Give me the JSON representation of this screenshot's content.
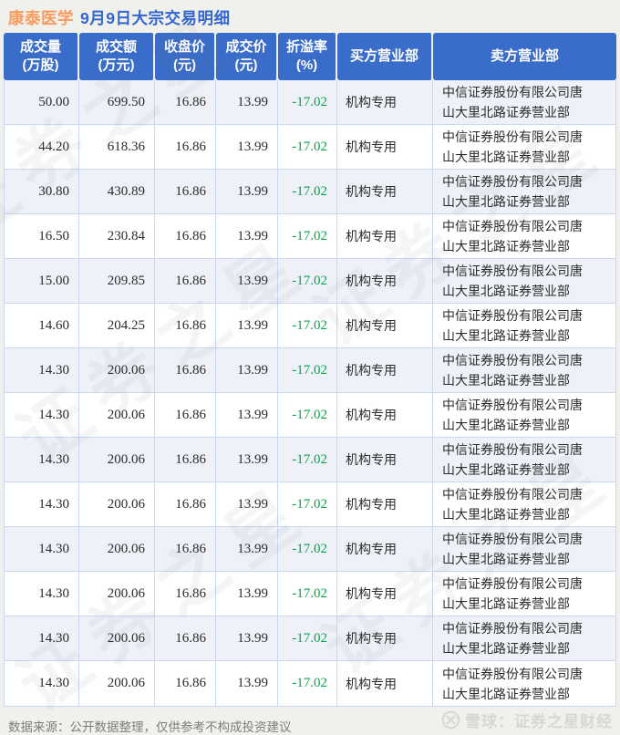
{
  "title": {
    "stock": "康泰医学",
    "rest": "9月9日大宗交易明细"
  },
  "colors": {
    "header_blue": "#3a6cc9",
    "title_blue": "#3566d0",
    "stock_orange": "#f99c5f",
    "premium_green": "#0aa24b",
    "row_alt_bg": "#eef1f8",
    "grid_border": "#c9d8ef",
    "page_bg": "#f0f0ec",
    "watermark_gray": "#d7d7d5"
  },
  "table": {
    "header": [
      {
        "line1": "成交量",
        "line2": "(万股)"
      },
      {
        "line1": "成交额",
        "line2": "(万元)"
      },
      {
        "line1": "收盘价",
        "line2": "(元)"
      },
      {
        "line1": "成交价",
        "line2": "(元)"
      },
      {
        "line1": "折溢率",
        "line2": "(%)"
      },
      {
        "line1": "买方营业部",
        "line2": ""
      },
      {
        "line1": "卖方营业部",
        "line2": ""
      }
    ]
  },
  "chart_data": {
    "type": "table",
    "title": "康泰医学 9月9日大宗交易明细",
    "columns": [
      "成交量(万股)",
      "成交额(万元)",
      "收盘价(元)",
      "成交价(元)",
      "折溢率(%)",
      "买方营业部",
      "卖方营业部"
    ],
    "rows": [
      [
        "50.00",
        "699.50",
        "16.86",
        "13.99",
        "-17.02",
        "机构专用",
        "中信证券股份有限公司唐山大里北路证券营业部"
      ],
      [
        "44.20",
        "618.36",
        "16.86",
        "13.99",
        "-17.02",
        "机构专用",
        "中信证券股份有限公司唐山大里北路证券营业部"
      ],
      [
        "30.80",
        "430.89",
        "16.86",
        "13.99",
        "-17.02",
        "机构专用",
        "中信证券股份有限公司唐山大里北路证券营业部"
      ],
      [
        "16.50",
        "230.84",
        "16.86",
        "13.99",
        "-17.02",
        "机构专用",
        "中信证券股份有限公司唐山大里北路证券营业部"
      ],
      [
        "15.00",
        "209.85",
        "16.86",
        "13.99",
        "-17.02",
        "机构专用",
        "中信证券股份有限公司唐山大里北路证券营业部"
      ],
      [
        "14.60",
        "204.25",
        "16.86",
        "13.99",
        "-17.02",
        "机构专用",
        "中信证券股份有限公司唐山大里北路证券营业部"
      ],
      [
        "14.30",
        "200.06",
        "16.86",
        "13.99",
        "-17.02",
        "机构专用",
        "中信证券股份有限公司唐山大里北路证券营业部"
      ],
      [
        "14.30",
        "200.06",
        "16.86",
        "13.99",
        "-17.02",
        "机构专用",
        "中信证券股份有限公司唐山大里北路证券营业部"
      ],
      [
        "14.30",
        "200.06",
        "16.86",
        "13.99",
        "-17.02",
        "机构专用",
        "中信证券股份有限公司唐山大里北路证券营业部"
      ],
      [
        "14.30",
        "200.06",
        "16.86",
        "13.99",
        "-17.02",
        "机构专用",
        "中信证券股份有限公司唐山大里北路证券营业部"
      ],
      [
        "14.30",
        "200.06",
        "16.86",
        "13.99",
        "-17.02",
        "机构专用",
        "中信证券股份有限公司唐山大里北路证券营业部"
      ],
      [
        "14.30",
        "200.06",
        "16.86",
        "13.99",
        "-17.02",
        "机构专用",
        "中信证券股份有限公司唐山大里北路证券营业部"
      ],
      [
        "14.30",
        "200.06",
        "16.86",
        "13.99",
        "-17.02",
        "机构专用",
        "中信证券股份有限公司唐山大里北路证券营业部"
      ],
      [
        "14.30",
        "200.06",
        "16.86",
        "13.99",
        "-17.02",
        "机构专用",
        "中信证券股份有限公司唐山大里北路证券营业部"
      ]
    ]
  },
  "footer": {
    "source": "数据来源：公开数据整理，仅供参考不构成投资建议",
    "brand": "雪球：证券之星财经"
  },
  "watermark": {
    "text": "证券之星"
  }
}
